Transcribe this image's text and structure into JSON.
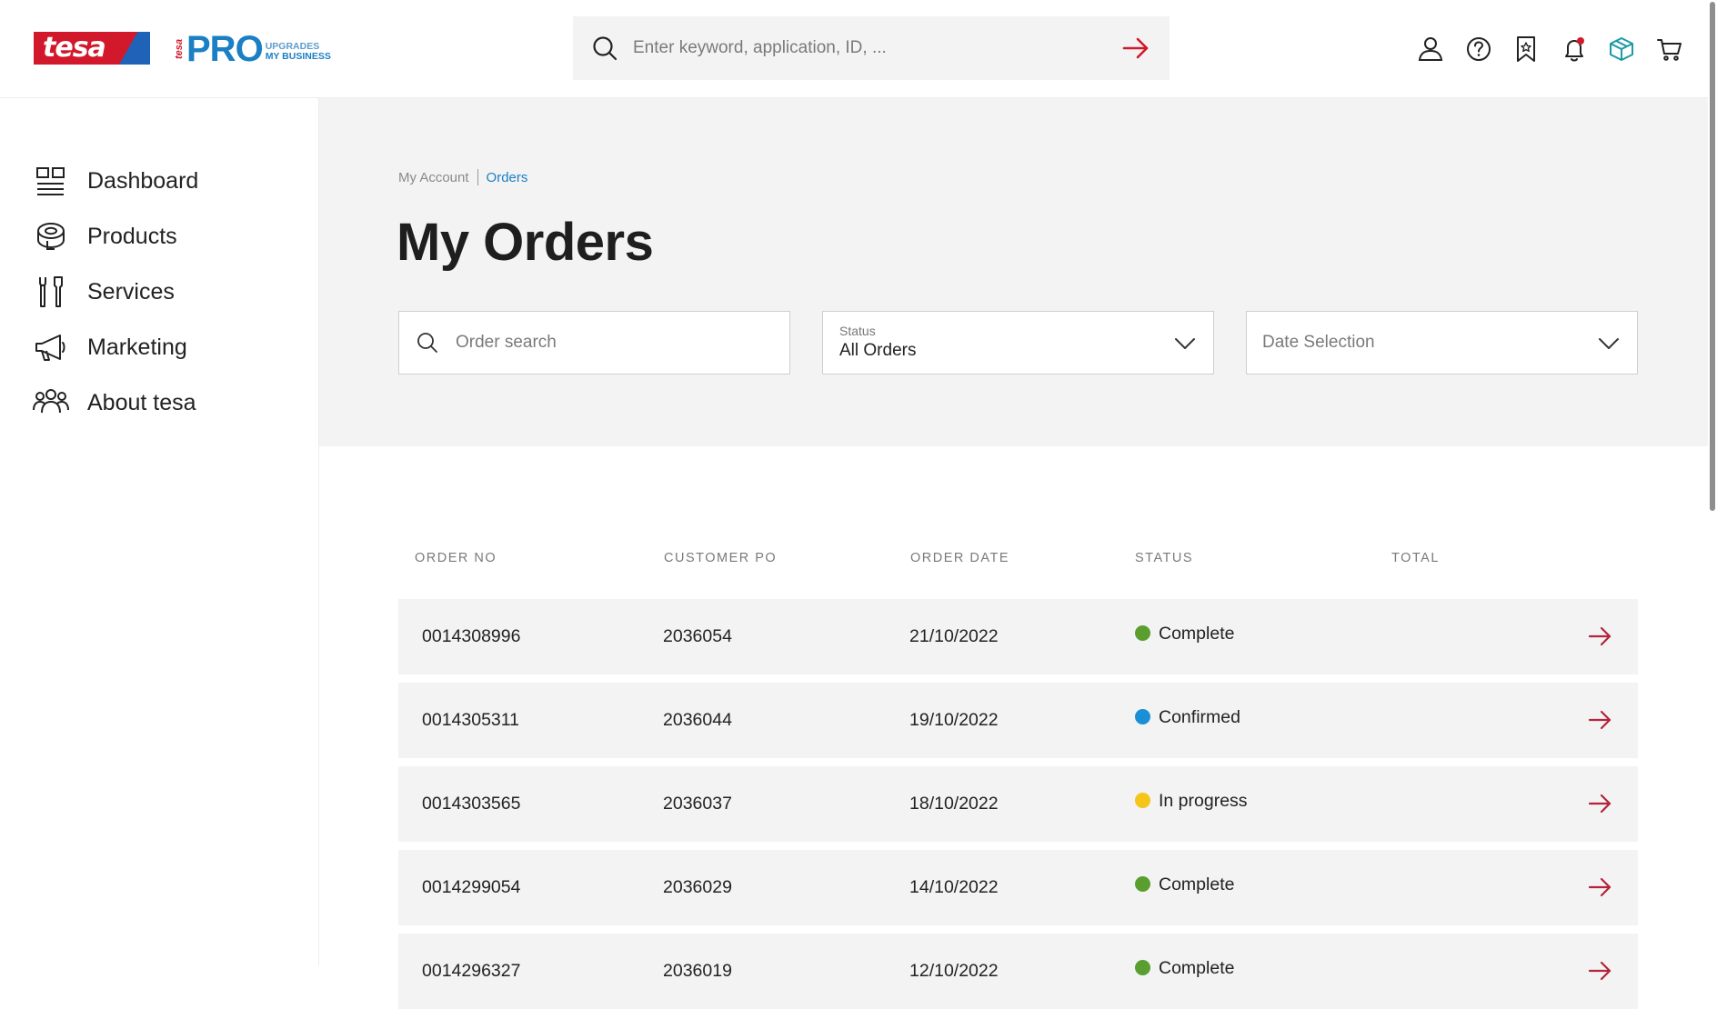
{
  "header": {
    "logo_text": "tesa",
    "pro_prefix": "tesa",
    "pro_text": "PRO",
    "pro_tag_line1": "UPGRADES",
    "pro_tag_line2": "MY BUSINESS",
    "search_placeholder": "Enter keyword, application, ID, ...",
    "icons": [
      "user-icon",
      "help-icon",
      "bookmark-icon",
      "bell-icon",
      "orders-box-icon",
      "cart-icon"
    ]
  },
  "sidebar": {
    "items": [
      {
        "label": "Dashboard",
        "icon": "dashboard-icon"
      },
      {
        "label": "Products",
        "icon": "tape-roll-icon"
      },
      {
        "label": "Services",
        "icon": "tools-icon"
      },
      {
        "label": "Marketing",
        "icon": "megaphone-icon"
      },
      {
        "label": "About tesa",
        "icon": "people-icon"
      }
    ]
  },
  "breadcrumb": {
    "items": [
      "My Account",
      "Orders"
    ]
  },
  "page_title": "My Orders",
  "filters": {
    "search_placeholder": "Order search",
    "status_label": "Status",
    "status_value": "All Orders",
    "date_placeholder": "Date Selection"
  },
  "table": {
    "columns": [
      "ORDER NO",
      "CUSTOMER PO",
      "ORDER DATE",
      "STATUS",
      "TOTAL"
    ],
    "rows": [
      {
        "order_no": "0014308996",
        "customer_po": "2036054",
        "order_date": "21/10/2022",
        "status": "Complete",
        "status_color": "#5a9e2f"
      },
      {
        "order_no": "0014305311",
        "customer_po": "2036044",
        "order_date": "19/10/2022",
        "status": "Confirmed",
        "status_color": "#1b8fd6"
      },
      {
        "order_no": "0014303565",
        "customer_po": "2036037",
        "order_date": "18/10/2022",
        "status": "In progress",
        "status_color": "#f5c518"
      },
      {
        "order_no": "0014299054",
        "customer_po": "2036029",
        "order_date": "14/10/2022",
        "status": "Complete",
        "status_color": "#5a9e2f"
      },
      {
        "order_no": "0014296327",
        "customer_po": "2036019",
        "order_date": "12/10/2022",
        "status": "Complete",
        "status_color": "#5a9e2f"
      }
    ]
  },
  "colors": {
    "brand_red": "#d2182b",
    "brand_blue": "#1b7fc4",
    "panel_gray": "#f3f3f3"
  }
}
